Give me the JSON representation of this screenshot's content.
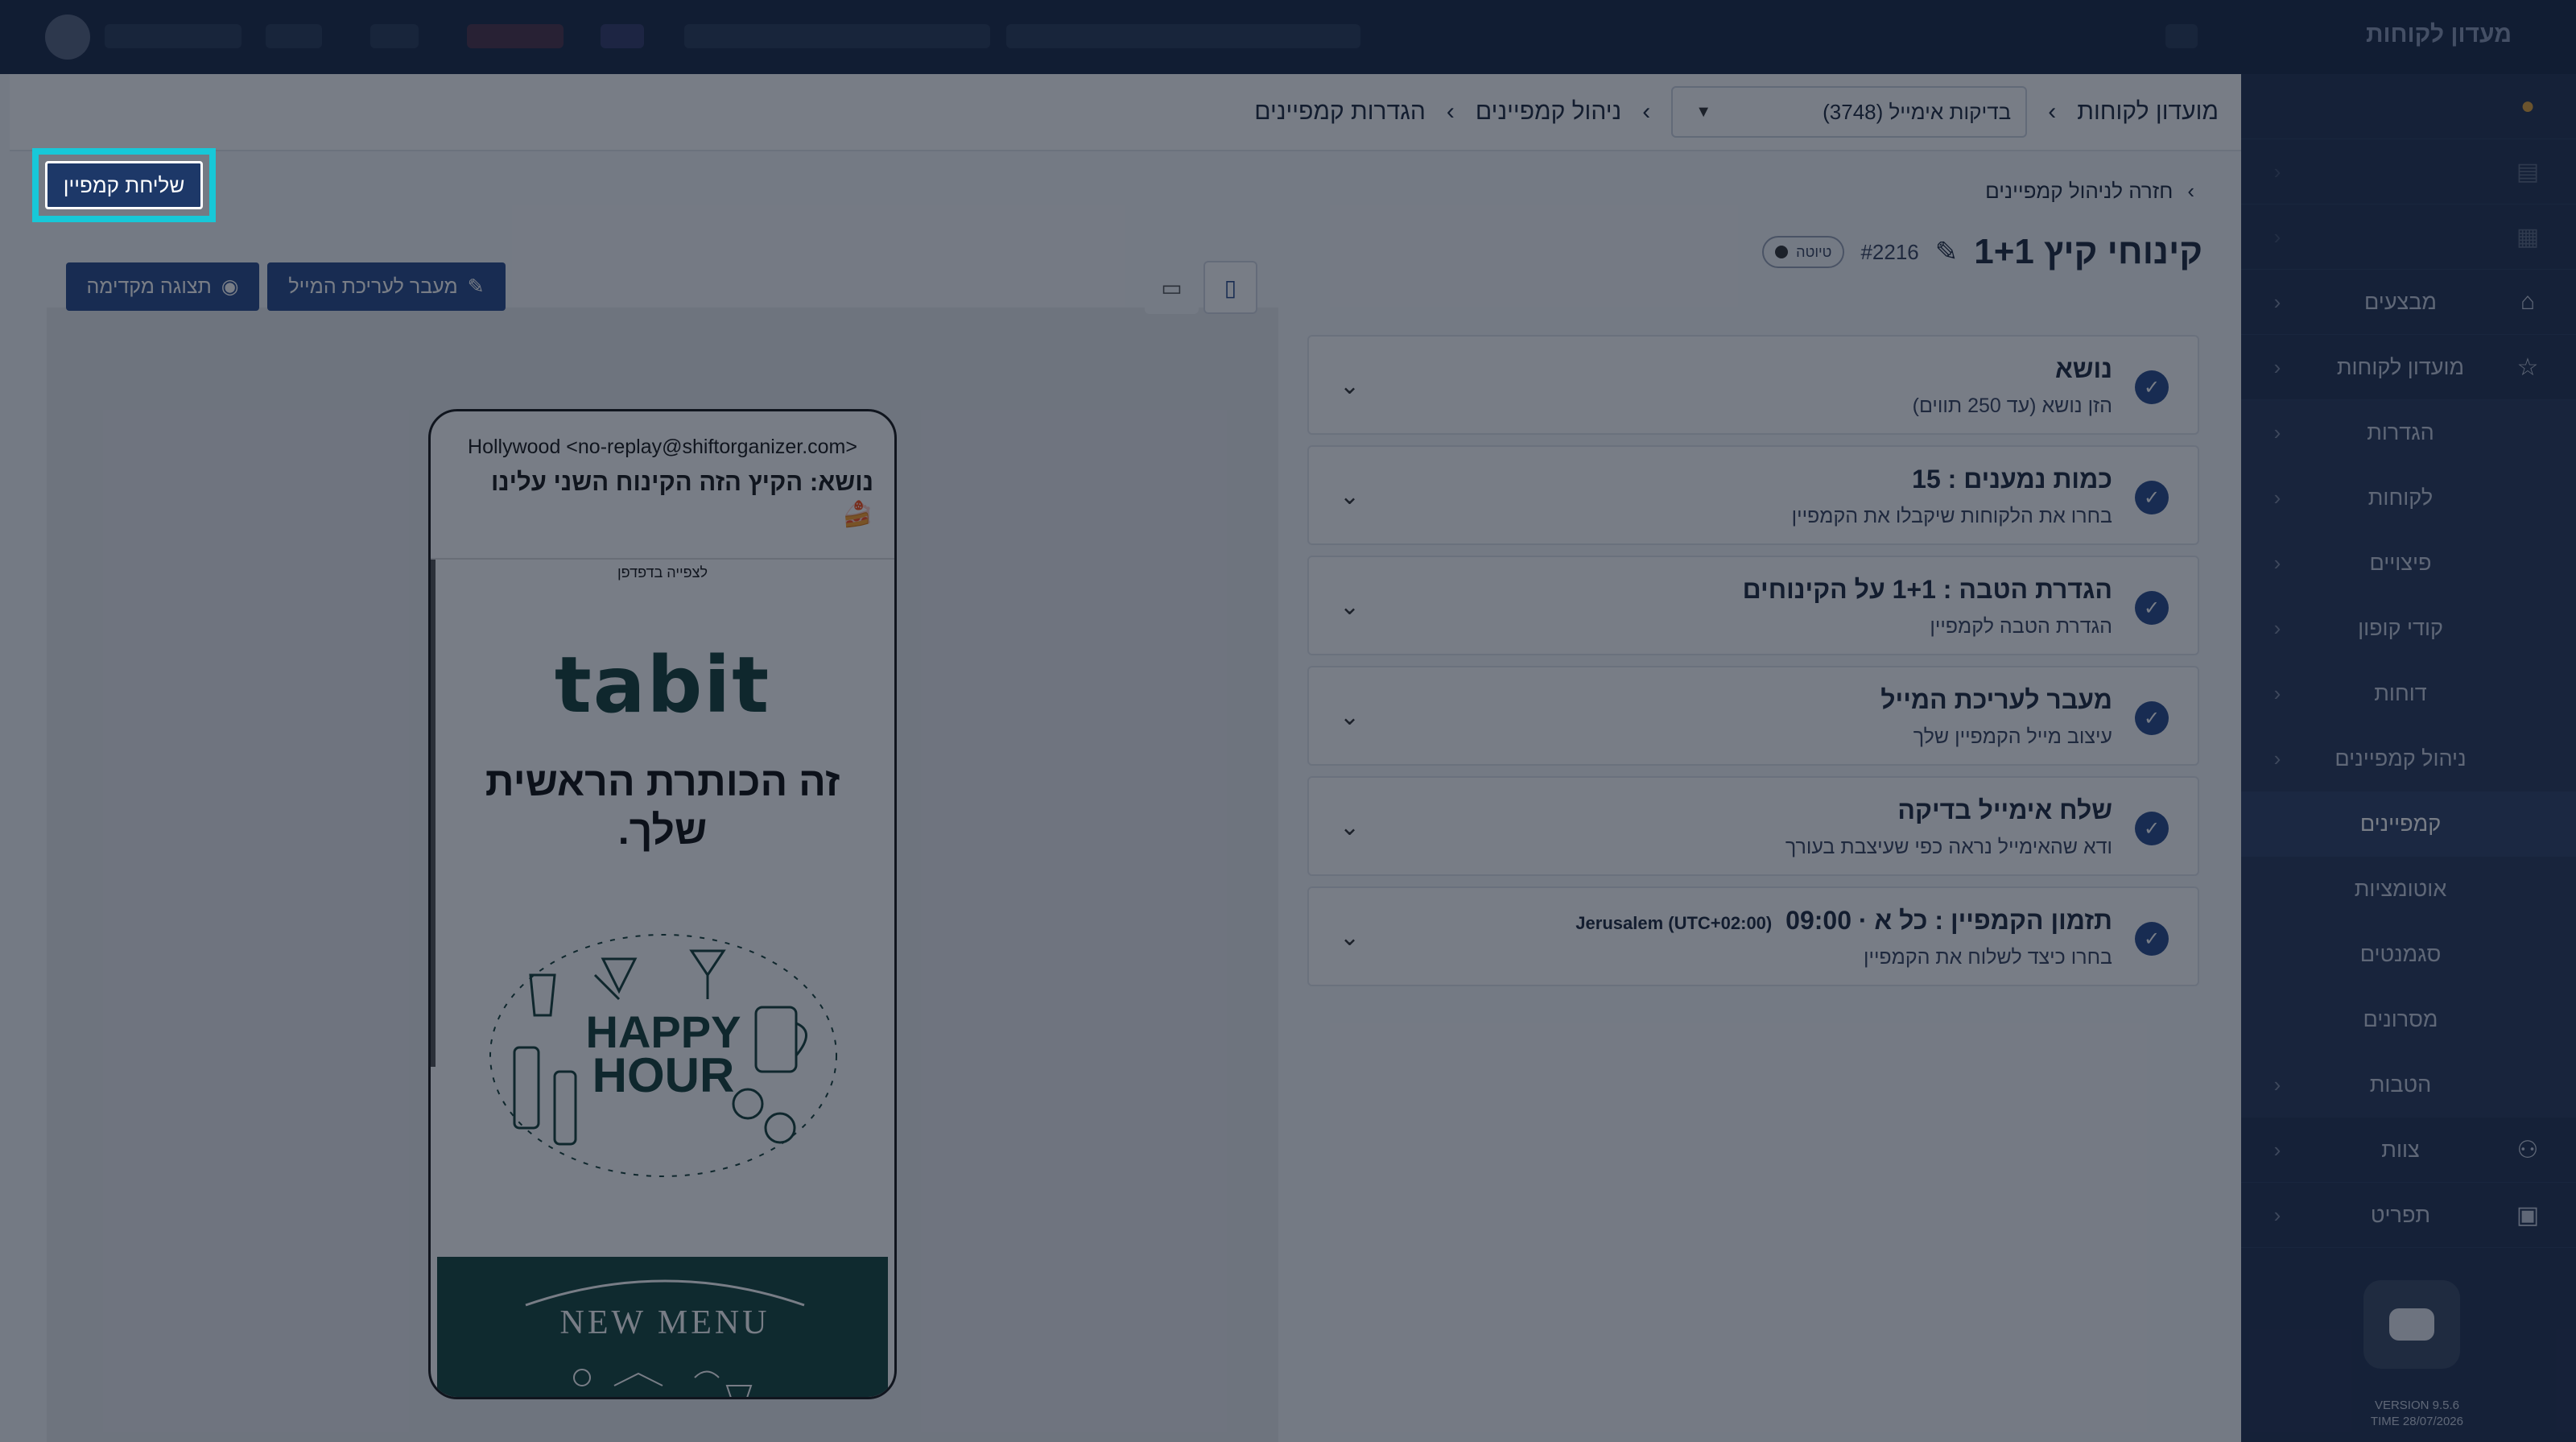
{
  "topbar": {
    "brand": "מעדון לקוחות"
  },
  "breadcrumb": {
    "club": "מועדון לקוחות",
    "select_value": "(3748) בדיקות אימייל",
    "manage": "ניהול קמפיינים",
    "settings": "הגדרות קמפיינים"
  },
  "back_link": "חזרה לניהול קמפיינים",
  "campaign": {
    "title": "קינוחי קיץ 1+1",
    "id": "#2216",
    "status": "טיוטה"
  },
  "send_button": "שליחת קמפיין",
  "preview_buttons": {
    "editor": "מעבר לעריכת המייל",
    "preview": "תצוגה מקדימה"
  },
  "steps": [
    {
      "title": "נושא",
      "subtitle": "הזן נושא (עד 250 תווים)"
    },
    {
      "title": "כמות נמענים : 15",
      "subtitle": "בחרו את הלקוחות שיקבלו את הקמפיין"
    },
    {
      "title": "הגדרת הטבה : 1+1 על הקינוחים",
      "subtitle": "הגדרת הטבה לקמפיין"
    },
    {
      "title": "מעבר לעריכת המייל",
      "subtitle": "עיצוב מייל הקמפיין שלך"
    },
    {
      "title": "שלח אימייל בדיקה",
      "subtitle": "ודא שהאימייל נראה כפי שעיצבת בעורך"
    },
    {
      "title": "תזמון הקמפיין : כל א · 09:00",
      "title_tz": "Jerusalem (UTC+02:00)",
      "subtitle": "בחרו כיצד לשלוח את הקמפיין"
    }
  ],
  "email_preview": {
    "from": "Hollywood <no-replay@shiftorganizer.com>",
    "subject": "נושא: הקיץ הזה הקינוח השני עלינו 🍰",
    "view_in_browser": "לצפייה בדפדפן",
    "logo": "tabit",
    "headline": "זה הכותרת הראשית שלך.",
    "happy_hour_line1": "HAPPY",
    "happy_hour_line2": "HOUR",
    "new_menu": "NEW MENU"
  },
  "sidebar": {
    "items": [
      {
        "label": "",
        "icon": "fire-icon",
        "dim": true
      },
      {
        "label": "",
        "icon": "chart-icon",
        "dim": true
      },
      {
        "label": "",
        "icon": "box-icon",
        "dim": true
      },
      {
        "label": "מבצעים",
        "icon": "tag-icon"
      },
      {
        "label": "מועדון לקוחות",
        "icon": "star-icon"
      },
      {
        "label": "הגדרות",
        "sub": true
      },
      {
        "label": "לקוחות",
        "sub": true
      },
      {
        "label": "פיצויים",
        "sub": true
      },
      {
        "label": "קודי קופון",
        "sub": true
      },
      {
        "label": "דוחות",
        "sub": true
      },
      {
        "label": "ניהול קמפיינים",
        "sub": true
      },
      {
        "label": "קמפיינים",
        "sub": true,
        "active": true
      },
      {
        "label": "אוטומציות",
        "sub": true
      },
      {
        "label": "סגמנטים",
        "sub": true
      },
      {
        "label": "מסרונים",
        "sub": true
      },
      {
        "label": "הטבות",
        "sub": true
      },
      {
        "label": "צוות",
        "icon": "users-icon"
      },
      {
        "label": "תפריט",
        "icon": "menu-icon"
      }
    ],
    "version": "VERSION 9.5.6",
    "time": "TIME 28/07/2026"
  },
  "colors": {
    "accent": "#2a4d8c",
    "highlight": "#17c8d8",
    "sidebar": "#243453"
  }
}
